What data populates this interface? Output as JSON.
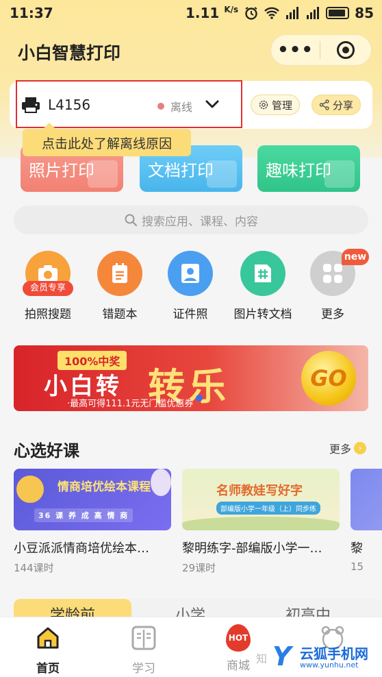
{
  "status_bar": {
    "time": "11:37",
    "speed": "1.11",
    "speed_unit": "K/s",
    "battery": "85",
    "network": "4G"
  },
  "header": {
    "title": "小白智慧打印",
    "menu_label": "•••"
  },
  "printer": {
    "name": "L4156",
    "status": "离线",
    "status_color": "#e8807a",
    "manage_label": "管理",
    "share_label": "分享",
    "tooltip": "点击此处了解离线原因"
  },
  "print_buttons": [
    {
      "label": "照片打印",
      "color": "#f28173"
    },
    {
      "label": "文档打印",
      "color": "#48b5ec"
    },
    {
      "label": "趣味打印",
      "color": "#30c489"
    }
  ],
  "search": {
    "placeholder": "搜索应用、课程、内容"
  },
  "features": [
    {
      "label": "拍照搜题",
      "badge": "会员专享",
      "color": "#f7a23b"
    },
    {
      "label": "错题本",
      "color": "#f5873b"
    },
    {
      "label": "证件照",
      "color": "#4a9ff0"
    },
    {
      "label": "图片转文档",
      "color": "#38c79a"
    },
    {
      "label": "更多",
      "badge": "new",
      "color": "#bdbdbd"
    }
  ],
  "banner": {
    "tag": "100%中奖",
    "line1": "小白转",
    "line2": "转乐",
    "line3": "·最高可得111.1元无门槛优惠券",
    "go": "GO"
  },
  "courses_section": {
    "title": "心选好课",
    "more_label": "更多",
    "courses": [
      {
        "title": "小豆派派情商培优绘本…",
        "lessons": "144课时",
        "thumb_text": "情商培优绘本课程",
        "thumb_sub": "36 课 养 成 高 情 商"
      },
      {
        "title": "黎明练字-部编版小学一…",
        "lessons": "29课时",
        "thumb_text": "名师教娃写好字",
        "thumb_sub": "部编版小学一年级（上）同步练"
      },
      {
        "title": "黎",
        "lessons": "15",
        "thumb_text": ""
      }
    ]
  },
  "category_tabs": [
    "学龄前",
    "小学",
    "初高中"
  ],
  "bottom_nav": [
    {
      "label": "首页",
      "active": true
    },
    {
      "label": "学习",
      "active": false
    },
    {
      "label": "商城",
      "active": false,
      "icon_text": "HOT"
    },
    {
      "label": "",
      "active": false
    }
  ],
  "watermark": {
    "zhi": "知",
    "name": "云狐手机网",
    "url": "www.yunhu.net"
  }
}
